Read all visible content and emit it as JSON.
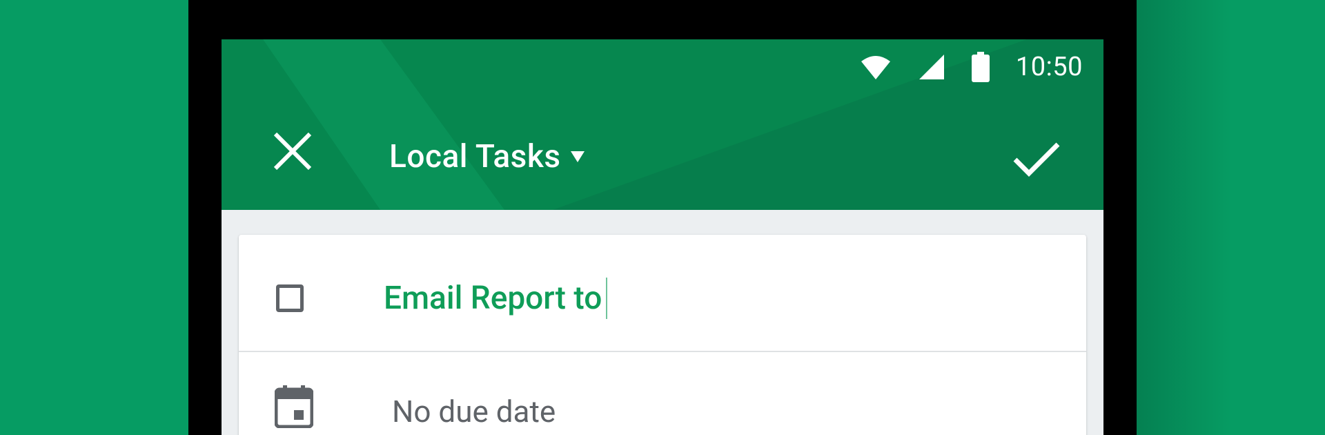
{
  "status_bar": {
    "time": "10:50"
  },
  "toolbar": {
    "list_name": "Local Tasks"
  },
  "task": {
    "title": "Email Report to"
  },
  "due_date": {
    "label": "No due date"
  },
  "colors": {
    "background": "#069c63",
    "appbar": "#06874f",
    "accent": "#0f9d58",
    "icon_gray": "#5f6368"
  },
  "icons": [
    "wifi-icon",
    "cellular-signal-icon",
    "battery-icon",
    "close-icon",
    "dropdown-arrow-icon",
    "check-icon",
    "checkbox-icon",
    "calendar-icon"
  ]
}
